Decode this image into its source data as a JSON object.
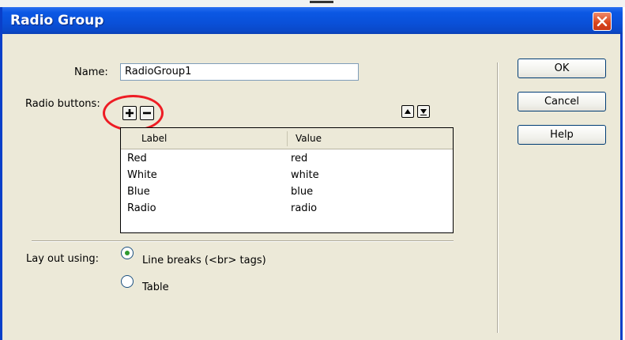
{
  "dialog": {
    "title": "Radio Group",
    "close_icon": "close-icon"
  },
  "form": {
    "name_label": "Name:",
    "name_value": "RadioGroup1",
    "radio_buttons_label": "Radio buttons:",
    "add_icon": "plus-icon",
    "remove_icon": "minus-icon",
    "move_up_icon": "up-arrow-icon",
    "move_down_icon": "down-arrow-icon"
  },
  "grid": {
    "columns": [
      "Label",
      "Value"
    ],
    "rows": [
      {
        "label": "Red",
        "value": "red"
      },
      {
        "label": "White",
        "value": "white"
      },
      {
        "label": "Blue",
        "value": "blue"
      },
      {
        "label": "Radio",
        "value": "radio"
      }
    ]
  },
  "layout": {
    "label": "Lay out using:",
    "options": [
      {
        "label": "Line breaks (<br> tags)",
        "selected": true
      },
      {
        "label": "Table",
        "selected": false
      }
    ]
  },
  "buttons": {
    "ok": "OK",
    "cancel": "Cancel",
    "help": "Help"
  },
  "colors": {
    "titlebar": "#0a50d8",
    "highlight_circle": "#ee1c24",
    "selected_radio": "#2f9a30"
  }
}
